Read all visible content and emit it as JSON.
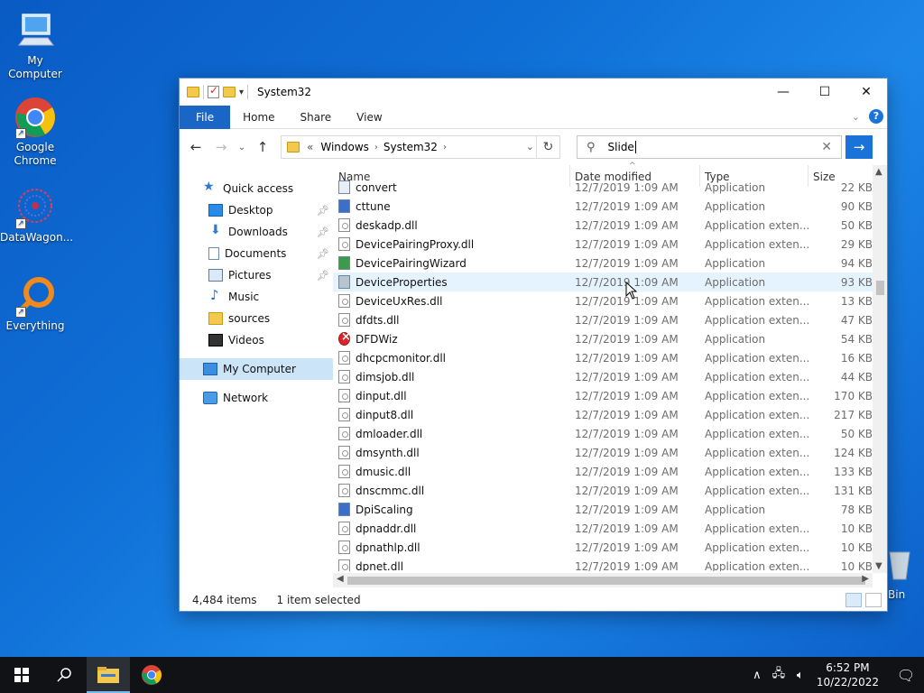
{
  "desktop": {
    "icons": [
      {
        "label": "My Computer",
        "icon": "computer-icon"
      },
      {
        "label": "Google Chrome",
        "icon": "chrome-icon"
      },
      {
        "label": "DataWagon...",
        "icon": "datawagon-icon"
      },
      {
        "label": "Everything",
        "icon": "everything-icon"
      }
    ],
    "recycle_label": "Bin"
  },
  "window": {
    "title": "System32",
    "ribbon_tabs": [
      "File",
      "Home",
      "Share",
      "View"
    ],
    "address": {
      "prefix": "«",
      "crumbs": [
        "Windows",
        "System32"
      ]
    },
    "search": {
      "value": "Slide"
    },
    "columns": {
      "name": "Name",
      "date": "Date modified",
      "type": "Type",
      "size": "Size"
    },
    "nav": {
      "quick_access": "Quick access",
      "items": [
        {
          "label": "Desktop",
          "icon": "desktop-icon",
          "pinned": true
        },
        {
          "label": "Downloads",
          "icon": "download-icon",
          "pinned": true
        },
        {
          "label": "Documents",
          "icon": "document-icon",
          "pinned": true
        },
        {
          "label": "Pictures",
          "icon": "pictures-icon",
          "pinned": true
        },
        {
          "label": "Music",
          "icon": "music-icon",
          "pinned": false
        },
        {
          "label": "sources",
          "icon": "folder-icon",
          "pinned": false
        },
        {
          "label": "Videos",
          "icon": "video-icon",
          "pinned": false
        }
      ],
      "my_computer": "My Computer",
      "network": "Network"
    },
    "files": [
      {
        "name": "convert",
        "date": "12/7/2019 1:09 AM",
        "type": "Application",
        "size": "22 KB",
        "icon": "app"
      },
      {
        "name": "cttune",
        "date": "12/7/2019 1:09 AM",
        "type": "Application",
        "size": "90 KB",
        "icon": "app-blue"
      },
      {
        "name": "deskadp.dll",
        "date": "12/7/2019 1:09 AM",
        "type": "Application exten...",
        "size": "50 KB",
        "icon": "dll"
      },
      {
        "name": "DevicePairingProxy.dll",
        "date": "12/7/2019 1:09 AM",
        "type": "Application exten...",
        "size": "29 KB",
        "icon": "dll"
      },
      {
        "name": "DevicePairingWizard",
        "date": "12/7/2019 1:09 AM",
        "type": "Application",
        "size": "94 KB",
        "icon": "app-green"
      },
      {
        "name": "DeviceProperties",
        "date": "12/7/2019 1:09 AM",
        "type": "Application",
        "size": "93 KB",
        "icon": "app-gear"
      },
      {
        "name": "DeviceUxRes.dll",
        "date": "12/7/2019 1:09 AM",
        "type": "Application exten...",
        "size": "13 KB",
        "icon": "dll"
      },
      {
        "name": "dfdts.dll",
        "date": "12/7/2019 1:09 AM",
        "type": "Application exten...",
        "size": "47 KB",
        "icon": "dll"
      },
      {
        "name": "DFDWiz",
        "date": "12/7/2019 1:09 AM",
        "type": "Application",
        "size": "54 KB",
        "icon": "err"
      },
      {
        "name": "dhcpcmonitor.dll",
        "date": "12/7/2019 1:09 AM",
        "type": "Application exten...",
        "size": "16 KB",
        "icon": "dll"
      },
      {
        "name": "dimsjob.dll",
        "date": "12/7/2019 1:09 AM",
        "type": "Application exten...",
        "size": "44 KB",
        "icon": "dll"
      },
      {
        "name": "dinput.dll",
        "date": "12/7/2019 1:09 AM",
        "type": "Application exten...",
        "size": "170 KB",
        "icon": "dll"
      },
      {
        "name": "dinput8.dll",
        "date": "12/7/2019 1:09 AM",
        "type": "Application exten...",
        "size": "217 KB",
        "icon": "dll"
      },
      {
        "name": "dmloader.dll",
        "date": "12/7/2019 1:09 AM",
        "type": "Application exten...",
        "size": "50 KB",
        "icon": "dll"
      },
      {
        "name": "dmsynth.dll",
        "date": "12/7/2019 1:09 AM",
        "type": "Application exten...",
        "size": "124 KB",
        "icon": "dll"
      },
      {
        "name": "dmusic.dll",
        "date": "12/7/2019 1:09 AM",
        "type": "Application exten...",
        "size": "133 KB",
        "icon": "dll"
      },
      {
        "name": "dnscmmc.dll",
        "date": "12/7/2019 1:09 AM",
        "type": "Application exten...",
        "size": "131 KB",
        "icon": "dll"
      },
      {
        "name": "DpiScaling",
        "date": "12/7/2019 1:09 AM",
        "type": "Application",
        "size": "78 KB",
        "icon": "app-blue"
      },
      {
        "name": "dpnaddr.dll",
        "date": "12/7/2019 1:09 AM",
        "type": "Application exten...",
        "size": "10 KB",
        "icon": "dll"
      },
      {
        "name": "dpnathlp.dll",
        "date": "12/7/2019 1:09 AM",
        "type": "Application exten...",
        "size": "10 KB",
        "icon": "dll"
      },
      {
        "name": "dpnet.dll",
        "date": "12/7/2019 1:09 AM",
        "type": "Application exten...",
        "size": "10 KB",
        "icon": "dll"
      }
    ],
    "status": {
      "count": "4,484 items",
      "selected": "1 item selected"
    }
  },
  "taskbar": {
    "time": "6:52 PM",
    "date": "10/22/2022"
  },
  "colors": {
    "accent": "#1a73d8",
    "file_tab": "#1966c7",
    "hover_row": "#e5f3ff",
    "selected_nav": "#cce4f7"
  }
}
